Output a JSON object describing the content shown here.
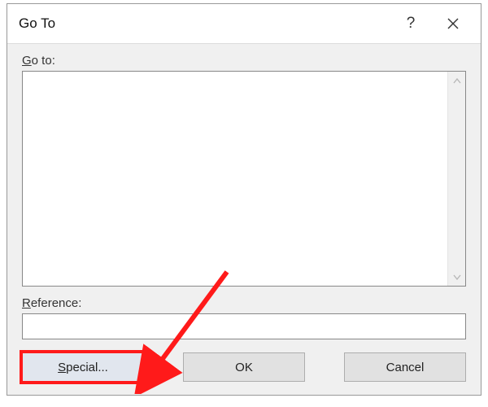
{
  "titlebar": {
    "title": "Go To"
  },
  "labels": {
    "goto": "Go to:",
    "goto_accel_char": "G",
    "reference": "Reference:",
    "reference_accel_char": "R"
  },
  "reference": {
    "value": ""
  },
  "buttons": {
    "special": "Special...",
    "special_accel_char": "S",
    "ok": "OK",
    "cancel": "Cancel"
  },
  "icons": {
    "help": "?",
    "close": "✕",
    "scroll_up": "˄",
    "scroll_down": "˅"
  },
  "annotation": {
    "highlight": "special-button"
  }
}
